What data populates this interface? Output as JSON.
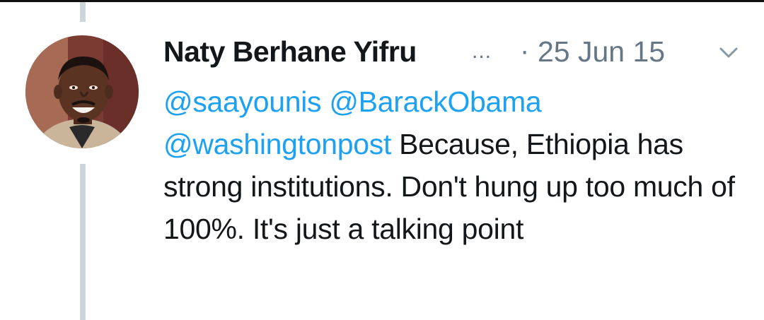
{
  "tweet": {
    "author_name": "Naty Berhane Yifru",
    "name_ellipsis": "...",
    "separator": "·",
    "date": "25 Jun 15",
    "menu_icon": "chevron-down-icon",
    "mentions": [
      "@saayounis",
      "@BarackObama",
      "@washingtonpost"
    ],
    "body_text": "Because, Ethiopia has strong institutions. Don't hung up too much of 100%. It's just a talking point"
  },
  "colors": {
    "text": "#14171a",
    "secondary": "#657786",
    "link": "#1da1f2",
    "thread_line": "#cdd6dd"
  }
}
